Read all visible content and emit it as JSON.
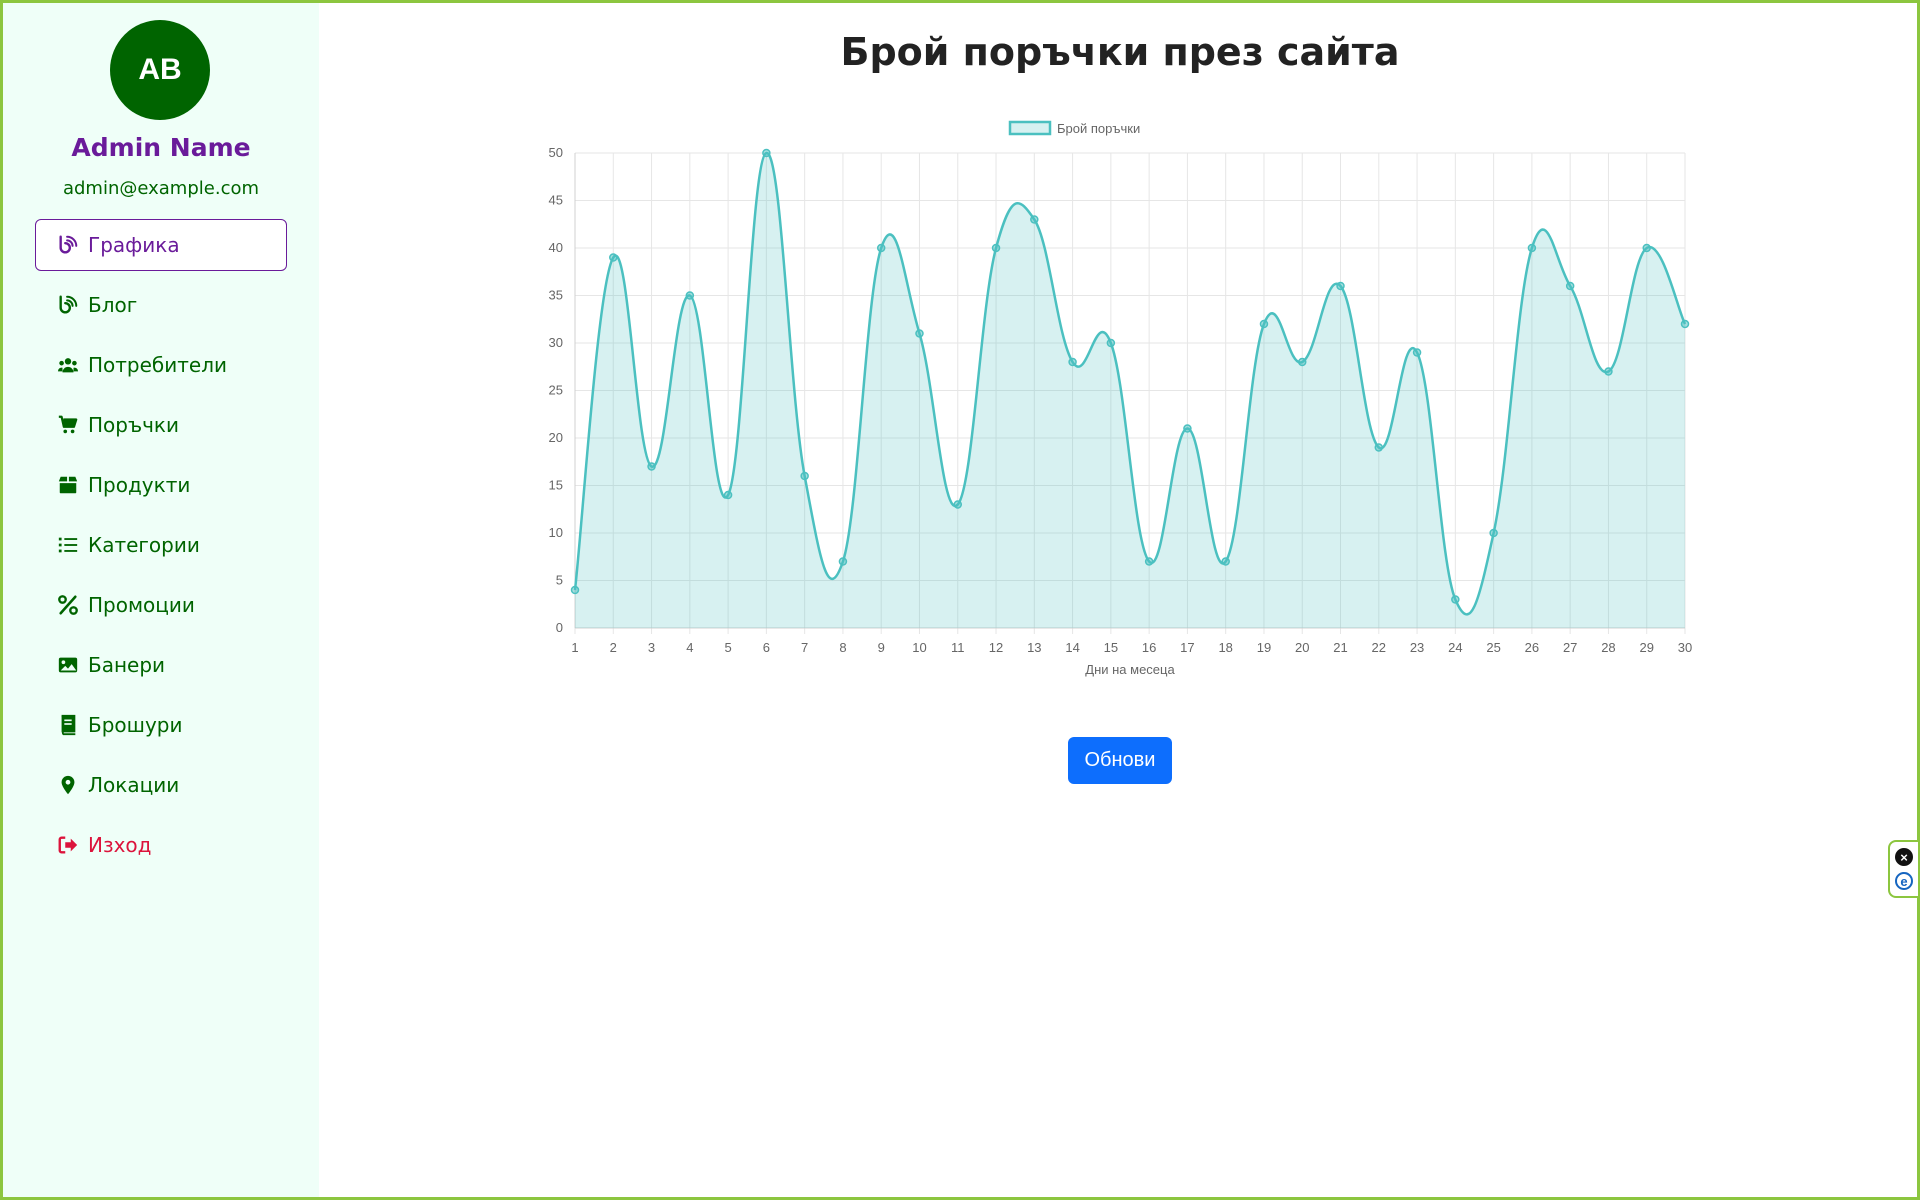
{
  "user": {
    "initials": "AB",
    "name": "Admin Name",
    "email": "admin@example.com"
  },
  "nav": [
    {
      "label": "Графика",
      "icon": "blog-icon",
      "active": true
    },
    {
      "label": "Блог",
      "icon": "blog-icon"
    },
    {
      "label": "Потребители",
      "icon": "users-icon"
    },
    {
      "label": "Поръчки",
      "icon": "cart-icon"
    },
    {
      "label": "Продукти",
      "icon": "box-icon"
    },
    {
      "label": "Категории",
      "icon": "list-icon"
    },
    {
      "label": "Промоции",
      "icon": "percent-icon"
    },
    {
      "label": "Банери",
      "icon": "image-icon"
    },
    {
      "label": "Брошури",
      "icon": "book-icon"
    },
    {
      "label": "Локации",
      "icon": "location-pin-icon"
    },
    {
      "label": "Изход",
      "icon": "sign-out-icon"
    }
  ],
  "colors": {
    "nav": "#006400",
    "active": "#6a1b9a",
    "logout": "#dc143c",
    "series": "#4bc0c0",
    "button": "#0d6efd"
  },
  "page_title": "Брой поръчки през сайта",
  "refresh_button": "Обнови",
  "chart_data": {
    "type": "area",
    "title": "",
    "xlabel": "Дни на месеца",
    "ylabel": "",
    "ylim": [
      0,
      50
    ],
    "ytick_step": 5,
    "grid": true,
    "legend": "top",
    "x": [
      1,
      2,
      3,
      4,
      5,
      6,
      7,
      8,
      9,
      10,
      11,
      12,
      13,
      14,
      15,
      16,
      17,
      18,
      19,
      20,
      21,
      22,
      23,
      24,
      25,
      26,
      27,
      28,
      29,
      30
    ],
    "series": [
      {
        "name": "Брой поръчки",
        "values": [
          4,
          39,
          17,
          35,
          14,
          50,
          16,
          7,
          40,
          31,
          13,
          40,
          43,
          28,
          30,
          7,
          21,
          7,
          32,
          28,
          36,
          19,
          29,
          3,
          10,
          40,
          36,
          27,
          40,
          32
        ]
      }
    ]
  }
}
